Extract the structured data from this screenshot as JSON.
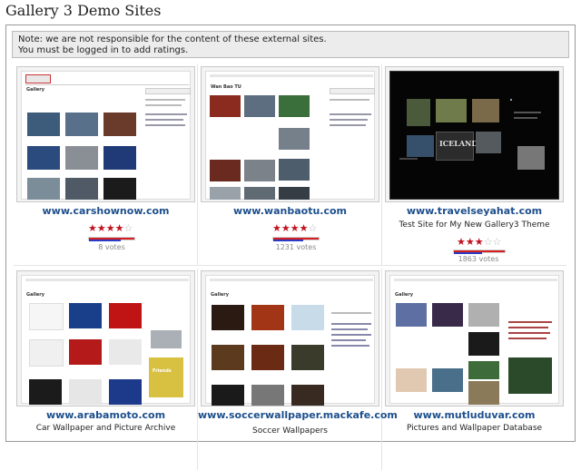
{
  "page_title": "Gallery 3 Demo Sites",
  "notice": {
    "line1": "Note: we are not responsible for the content of these external sites.",
    "line2": "You must be logged in to add ratings."
  },
  "sites": [
    {
      "url": "www.carshownow.com",
      "description": "",
      "rating": 3.5,
      "votes": "8 votes",
      "vote_fill": 0.7
    },
    {
      "url": "www.wanbaotu.com",
      "description": "",
      "rating": 3.5,
      "votes": "1231 votes",
      "vote_fill": 0.65
    },
    {
      "url": "www.travelseyahat.com",
      "description": "Test Site for My New Gallery3 Theme",
      "rating": 2.5,
      "votes": "1863 votes",
      "vote_fill": 0.55
    },
    {
      "url": "www.arabamoto.com",
      "description": "Car Wallpaper and Picture Archive",
      "rating": null,
      "votes": "",
      "vote_fill": null
    },
    {
      "url": "www.soccerwallpaper.mackafe.com",
      "description": "Soccer Wallpapers",
      "rating": null,
      "votes": "",
      "vote_fill": null
    },
    {
      "url": "www.mutluduvar.com",
      "description": "Pictures and Wallpaper Database",
      "rating": null,
      "votes": "",
      "vote_fill": null
    }
  ],
  "thumb_texts": {
    "gallery": "Gallery",
    "wanbao": "Wan Bao TU",
    "iceland": "ICELAND",
    "friends": "Friends"
  },
  "colors": {
    "link": "#1d4f8c",
    "star_on": "#c1121f",
    "bar_red": "#d42020",
    "bar_blue": "#2a3cc4"
  }
}
